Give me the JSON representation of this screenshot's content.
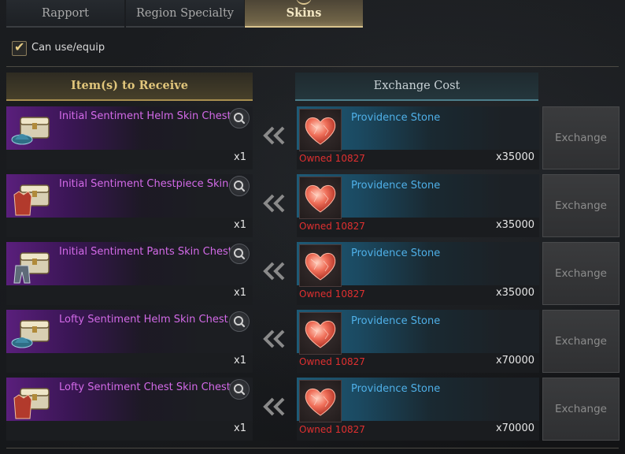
{
  "tabs": [
    {
      "label": "Rapport",
      "active": false
    },
    {
      "label": "Region Specialty",
      "active": false
    },
    {
      "label": "Skins",
      "active": true
    }
  ],
  "filter": {
    "label": "Can use/equip",
    "checked": true
  },
  "columns": {
    "receive": "Item(s) to Receive",
    "cost": "Exchange Cost"
  },
  "rows": [
    {
      "item_name": "Initial Sentiment Helm Skin Chest",
      "item_icon": "helm-chest-icon",
      "quantity": "x1",
      "cost_name": "Providence Stone",
      "owned": "Owned 10827",
      "cost": "x35000",
      "button": "Exchange"
    },
    {
      "item_name": "Initial Sentiment Chestpiece Skin.",
      "item_icon": "chestpiece-chest-icon",
      "quantity": "x1",
      "cost_name": "Providence Stone",
      "owned": "Owned 10827",
      "cost": "x35000",
      "button": "Exchange"
    },
    {
      "item_name": "Initial Sentiment Pants Skin Chest",
      "item_icon": "pants-chest-icon",
      "quantity": "x1",
      "cost_name": "Providence Stone",
      "owned": "Owned 10827",
      "cost": "x35000",
      "button": "Exchange"
    },
    {
      "item_name": "Lofty Sentiment Helm Skin Chest",
      "item_icon": "helm-chest-icon",
      "quantity": "x1",
      "cost_name": "Providence Stone",
      "owned": "Owned 10827",
      "cost": "x70000",
      "button": "Exchange"
    },
    {
      "item_name": "Lofty Sentiment Chest Skin Chest",
      "item_icon": "chestpiece-chest-icon",
      "quantity": "x1",
      "cost_name": "Providence Stone",
      "owned": "Owned 10827",
      "cost": "x70000",
      "button": "Exchange"
    }
  ],
  "colors": {
    "active_tab": "#d9c48f",
    "item_name": "#d36ae8",
    "cost_name": "#4fb0e8",
    "owned": "#e03030",
    "rarity_glow": "#5a1f7c",
    "cost_glow": "#1e5a76"
  }
}
